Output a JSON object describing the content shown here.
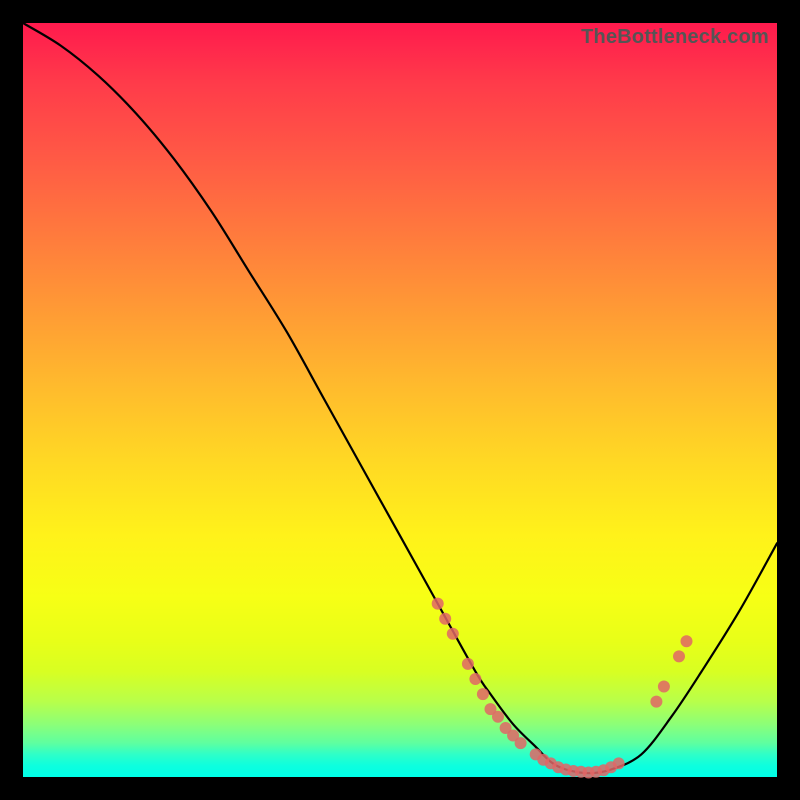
{
  "watermark": "TheBottleneck.com",
  "colors": {
    "frame_bg": "#000000",
    "marker": "#e06666",
    "curve": "#000000"
  },
  "chart_data": {
    "type": "line",
    "title": "",
    "xlabel": "",
    "ylabel": "",
    "xlim": [
      0,
      100
    ],
    "ylim": [
      0,
      100
    ],
    "series": [
      {
        "name": "bottleneck-curve",
        "x": [
          0,
          5,
          10,
          15,
          20,
          25,
          30,
          35,
          40,
          45,
          50,
          55,
          60,
          62,
          65,
          68,
          70,
          72,
          75,
          78,
          82,
          86,
          90,
          95,
          100
        ],
        "y": [
          100,
          97,
          93,
          88,
          82,
          75,
          67,
          59,
          50,
          41,
          32,
          23,
          14,
          11,
          7,
          4,
          2,
          1,
          0.5,
          1,
          3,
          8,
          14,
          22,
          31
        ]
      }
    ],
    "markers": {
      "name": "sample-points",
      "points": [
        {
          "x": 55,
          "y": 23
        },
        {
          "x": 56,
          "y": 21
        },
        {
          "x": 57,
          "y": 19
        },
        {
          "x": 59,
          "y": 15
        },
        {
          "x": 60,
          "y": 13
        },
        {
          "x": 61,
          "y": 11
        },
        {
          "x": 62,
          "y": 9
        },
        {
          "x": 63,
          "y": 8
        },
        {
          "x": 64,
          "y": 6.5
        },
        {
          "x": 65,
          "y": 5.5
        },
        {
          "x": 66,
          "y": 4.5
        },
        {
          "x": 68,
          "y": 3
        },
        {
          "x": 69,
          "y": 2.3
        },
        {
          "x": 70,
          "y": 1.8
        },
        {
          "x": 71,
          "y": 1.3
        },
        {
          "x": 72,
          "y": 1.0
        },
        {
          "x": 73,
          "y": 0.8
        },
        {
          "x": 74,
          "y": 0.7
        },
        {
          "x": 75,
          "y": 0.6
        },
        {
          "x": 76,
          "y": 0.7
        },
        {
          "x": 77,
          "y": 0.9
        },
        {
          "x": 78,
          "y": 1.3
        },
        {
          "x": 79,
          "y": 1.8
        },
        {
          "x": 84,
          "y": 10
        },
        {
          "x": 85,
          "y": 12
        },
        {
          "x": 87,
          "y": 16
        },
        {
          "x": 88,
          "y": 18
        }
      ]
    }
  }
}
